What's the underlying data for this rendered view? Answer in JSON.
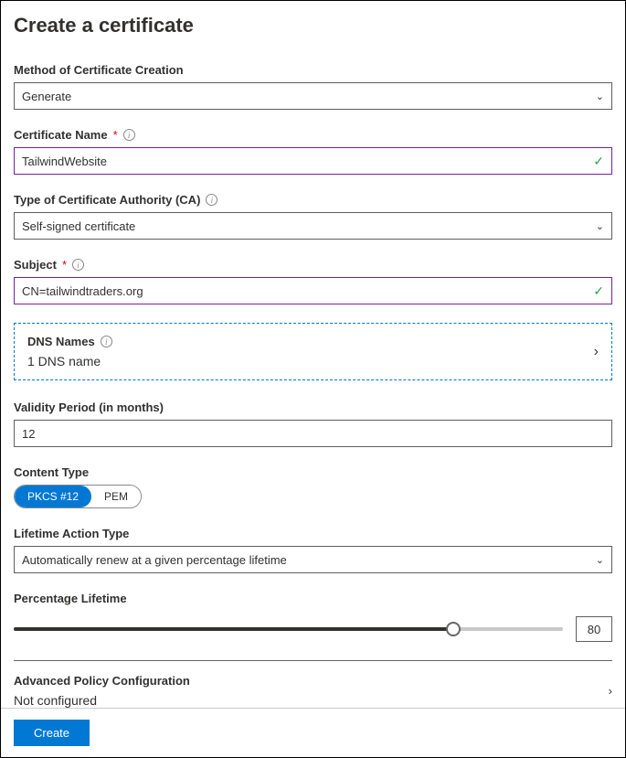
{
  "title": "Create a certificate",
  "method": {
    "label": "Method of Certificate Creation",
    "value": "Generate"
  },
  "certName": {
    "label": "Certificate Name",
    "value": "TailwindWebsite"
  },
  "caType": {
    "label": "Type of Certificate Authority (CA)",
    "value": "Self-signed certificate"
  },
  "subject": {
    "label": "Subject",
    "value": "CN=tailwindtraders.org"
  },
  "dns": {
    "label": "DNS Names",
    "value": "1 DNS name"
  },
  "validity": {
    "label": "Validity Period (in months)",
    "value": "12"
  },
  "contentType": {
    "label": "Content Type",
    "options": [
      "PKCS #12",
      "PEM"
    ],
    "selected": "PKCS #12"
  },
  "lifetimeAction": {
    "label": "Lifetime Action Type",
    "value": "Automatically renew at a given percentage lifetime"
  },
  "percentage": {
    "label": "Percentage Lifetime",
    "value": "80"
  },
  "advanced": {
    "label": "Advanced Policy Configuration",
    "value": "Not configured"
  },
  "buttons": {
    "create": "Create"
  }
}
